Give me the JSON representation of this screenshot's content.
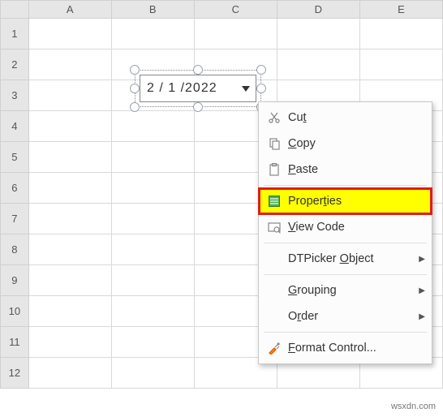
{
  "columns": [
    "A",
    "B",
    "C",
    "D",
    "E"
  ],
  "rows": [
    "1",
    "2",
    "3",
    "4",
    "5",
    "6",
    "7",
    "8",
    "9",
    "10",
    "11",
    "12"
  ],
  "dtpicker": {
    "value": "2 / 1 /2022"
  },
  "menu": {
    "cut": "Cut",
    "copy": "Copy",
    "paste": "Paste",
    "properties": "Properties",
    "viewcode": "View Code",
    "dtobj": "DTPicker Object",
    "grouping": "Grouping",
    "order": "Order",
    "formatcontrol": "Format Control..."
  },
  "watermark": "wsxdn.com"
}
